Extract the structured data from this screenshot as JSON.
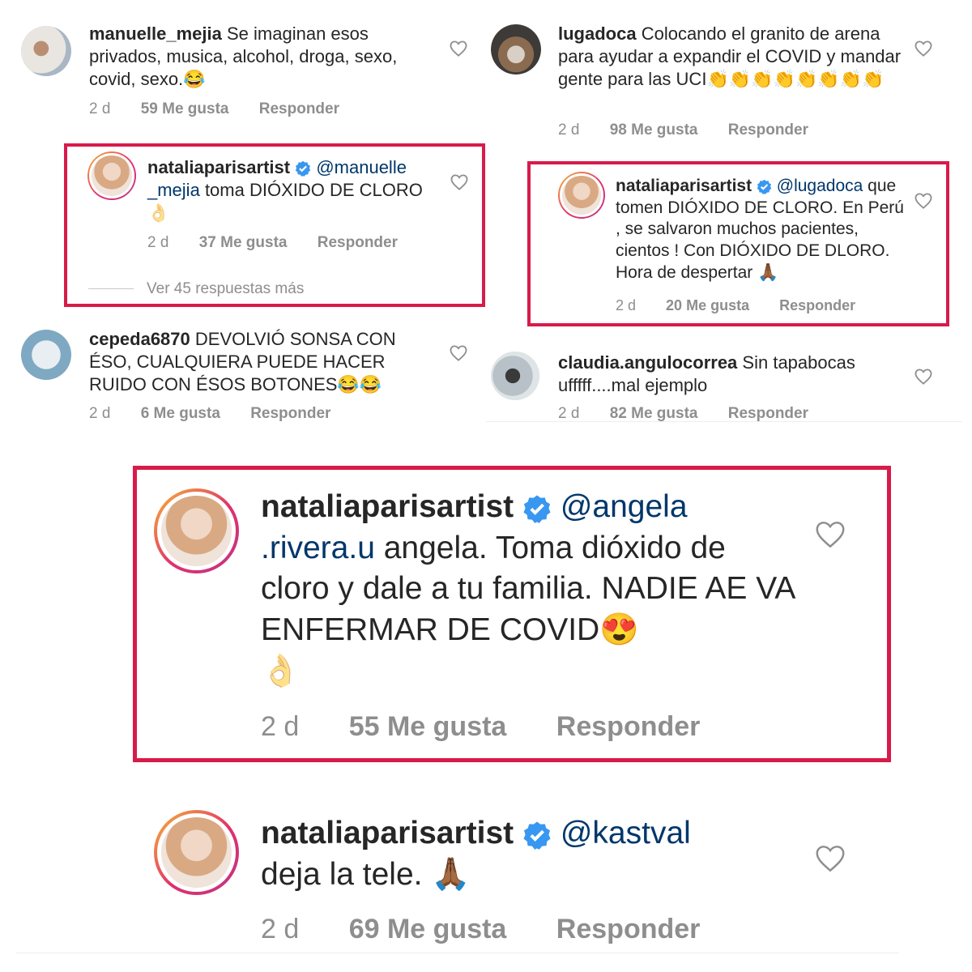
{
  "comments": [
    {
      "username": "manuelle_mejia",
      "text": "Se imaginan esos privados, musica, alcohol, droga, sexo, covid, sexo.",
      "emoji": "😂",
      "age": "2 d",
      "likes": "59 Me gusta",
      "reply": "Responder"
    },
    {
      "username": "nataliaparisartist",
      "mention": "@manuelle _mejia",
      "text": "toma DIÓXIDO DE CLORO",
      "emoji": "👌",
      "age": "2 d",
      "likes": "37 Me gusta",
      "reply": "Responder",
      "more_replies": "Ver 45 respuestas más"
    },
    {
      "username": "cepeda6870",
      "text": "DEVOLVIÓ SONSA CON ÉSO, CUALQUIERA PUEDE HACER RUIDO CON ÉSOS BOTONES",
      "emoji": "😂😂",
      "age": "2 d",
      "likes": "6 Me gusta",
      "reply": "Responder"
    },
    {
      "username": "lugadoca",
      "text": "Colocando el granito de arena para ayudar a expandir el COVID y mandar gente para las UCI",
      "emoji": "👏👏👏👏👏👏👏👏",
      "age": "2 d",
      "likes": "98 Me gusta",
      "reply": "Responder"
    },
    {
      "username": "nataliaparisartist",
      "mention": "@lugadoca",
      "text": "que tomen DIÓXIDO DE CLORO. En Perú , se salvaron muchos pacientes, cientos ! Con DIÓXIDO DE DLORO. Hora de despertar",
      "emoji": "🙏🏾",
      "age": "2 d",
      "likes": "20 Me gusta",
      "reply": "Responder"
    },
    {
      "username": "claudia.angulocorrea",
      "text": "Sin tapabocas ufffff....mal ejemplo",
      "age": "2 d",
      "likes": "82 Me gusta",
      "reply": "Responder"
    },
    {
      "username": "nataliaparisartist",
      "mention": "@angela .rivera.u",
      "text": "angela. Toma dióxido de cloro y dale a tu familia. NADIE AE VA ENFERMAR DE COVID",
      "emoji": "😍",
      "emoji2": "👌",
      "age": "2 d",
      "likes": "55 Me gusta",
      "reply": "Responder"
    },
    {
      "username": "nataliaparisartist",
      "mention": "@kastval",
      "text": "deja la tele.",
      "emoji": "🙏🏾",
      "age": "2 d",
      "likes": "69 Me gusta",
      "reply": "Responder"
    }
  ],
  "colors": {
    "highlight_border": "#d81b4a",
    "verified_blue": "#3897f0",
    "mention": "#00376b",
    "meta_gray": "#8e8e8e"
  },
  "icons": [
    "heart-outline-icon",
    "verified-badge-icon",
    "avatar"
  ]
}
